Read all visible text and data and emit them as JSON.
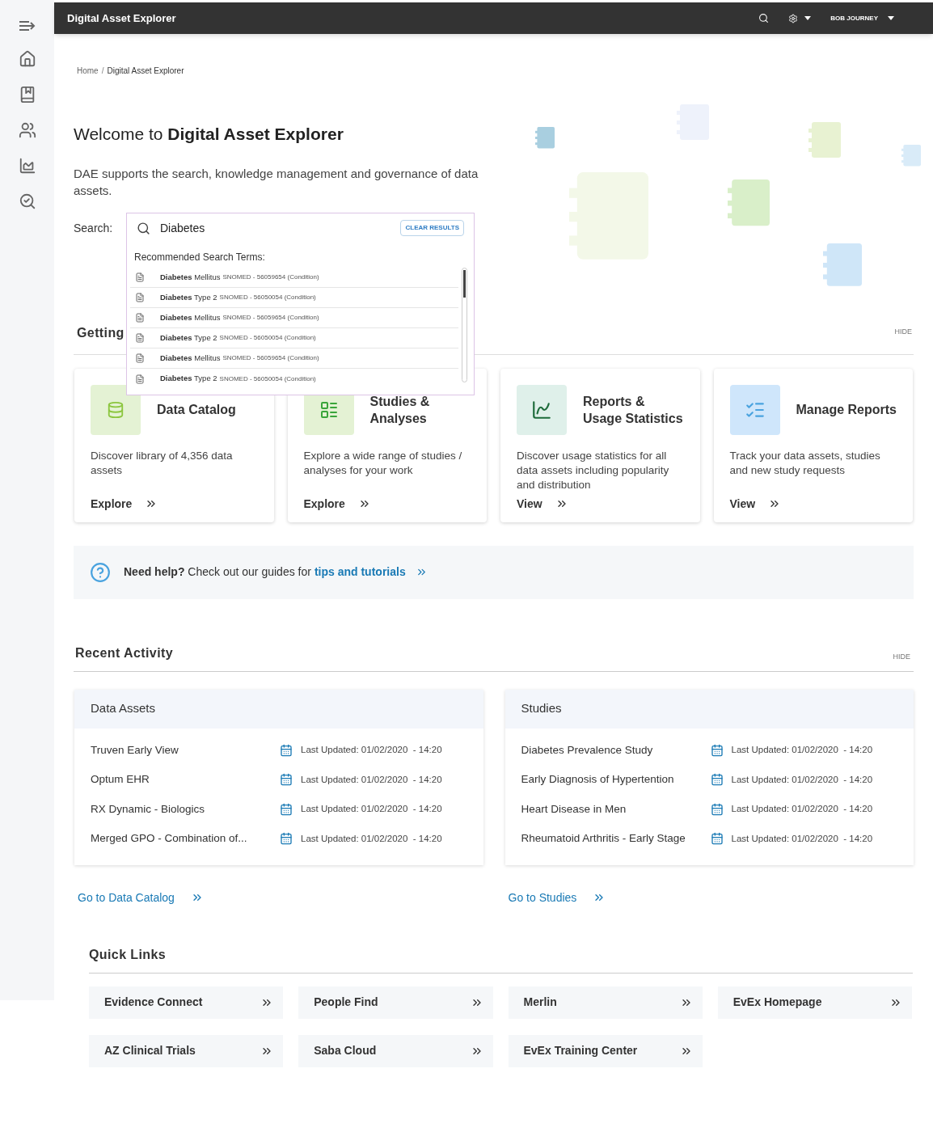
{
  "app_bar": {
    "title": "Digital Asset Explorer",
    "user": "BOB JOURNEY"
  },
  "breadcrumb": [
    {
      "label": "Home"
    },
    {
      "label": "Digital Asset Explorer"
    }
  ],
  "breadcrumb_separator": "/",
  "welcome": {
    "prefix": "Welcome to",
    "name": "Digital Asset Explorer",
    "description": "DAE supports the search, knowledge management and governance of data assets."
  },
  "search": {
    "label": "Search:",
    "value": "Diabetes",
    "clear_button": "CLEAR RESULTS",
    "suggestions_title": "Recommended Search Terms:",
    "suggestions": [
      {
        "term": "**Diabetes** Mellitus",
        "code": "SNOMED - 56059654 (Condition)"
      },
      {
        "term": "**Diabetes** Type 2",
        "code": "SNOMED - 56050054 (Condition)"
      },
      {
        "term": "**Diabetes** Mellitus",
        "code": "SNOMED - 56059654 (Condition)"
      },
      {
        "term": "**Diabetes** Type 2",
        "code": "SNOMED - 56050054 (Condition)"
      },
      {
        "term": "**Diabetes** Mellitus",
        "code": "SNOMED - 56059654 (Condition)"
      },
      {
        "term": "**Diabetes** Type 2",
        "code": "SNOMED - 56050054 (Condition)"
      }
    ]
  },
  "getting_started": {
    "heading": "Getting",
    "hide": "HIDE",
    "cards": [
      {
        "kind": "database",
        "color": "#e4f2d4",
        "title": "Data Catalog",
        "description": "Discover library of 4,356 data assets",
        "action": "Explore"
      },
      {
        "kind": "list",
        "color": "#e4f2d4",
        "title": "Studies & Analyses",
        "description": "Explore a wide range of studies / analyses for your work",
        "action": "Explore"
      },
      {
        "kind": "chart",
        "color": "#dff0ea",
        "title": "Reports & Usage Statistics",
        "description": "Discover usage statistics for all data assets including popularity and distribution",
        "action": "View"
      },
      {
        "kind": "checklist",
        "color": "#cfe6fb",
        "title": "Manage Reports",
        "description": "Track your data assets, studies and new study requests",
        "action": "View"
      }
    ]
  },
  "help": {
    "text": "**Need help?** Check out our guides for",
    "link": "tips and tutorials"
  },
  "recent_activity": {
    "heading": "Recent Activity",
    "hide": "HIDE",
    "panels": [
      {
        "title": "Data Assets",
        "link": "Go to Data Catalog",
        "rows": [
          {
            "name": "Truven Early View",
            "updated": "Last Updated: 01/02/2020  - 14:20"
          },
          {
            "name": "Optum EHR",
            "updated": "Last Updated: 01/02/2020  - 14:20"
          },
          {
            "name": "RX Dynamic - Biologics",
            "updated": "Last Updated: 01/02/2020  - 14:20"
          },
          {
            "name": "Merged GPO - Combination of...",
            "updated": "Last Updated: 01/02/2020  - 14:20"
          }
        ]
      },
      {
        "title": "Studies",
        "link": "Go to Studies",
        "rows": [
          {
            "name": "Diabetes Prevalence Study",
            "updated": "Last Updated: 01/02/2020  - 14:20"
          },
          {
            "name": "Early Diagnosis of Hypertention",
            "updated": "Last Updated: 01/02/2020  - 14:20"
          },
          {
            "name": "Heart Disease in Men",
            "updated": "Last Updated: 01/02/2020  - 14:20"
          },
          {
            "name": "Rheumatoid Arthritis - Early Stage",
            "updated": "Last Updated: 01/02/2020  - 14:20"
          }
        ]
      }
    ]
  },
  "quick_links": {
    "heading": "Quick Links",
    "links": [
      {
        "label": "Evidence Connect"
      },
      {
        "label": "People Find"
      },
      {
        "label": "Merlin"
      },
      {
        "label": "EvEx Homepage"
      },
      {
        "label": "AZ Clinical Trials"
      },
      {
        "label": "Saba Cloud"
      },
      {
        "label": "EvEx Training Center"
      }
    ]
  }
}
